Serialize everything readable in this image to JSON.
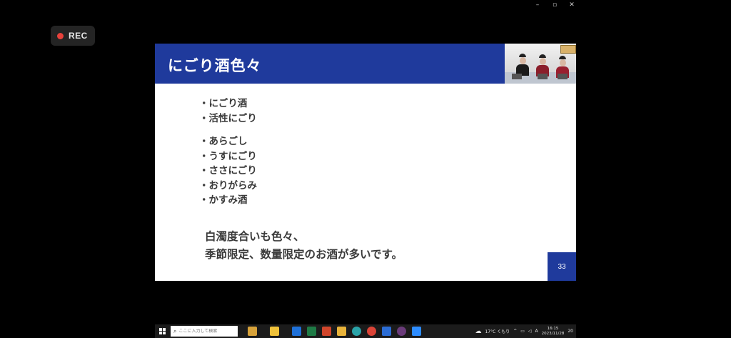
{
  "window": {
    "minimize_icon": "minimize-icon",
    "maximize_icon": "maximize-icon",
    "close_icon": "close-icon",
    "minimize_glyph": "–",
    "maximize_glyph": "▫",
    "close_glyph": "✕"
  },
  "recording": {
    "label": "REC",
    "color": "#e8413b"
  },
  "slide": {
    "title": "にごり酒色々",
    "header_color": "#1f3a9c",
    "bullets_group1": [
      "にごり酒",
      "活性にごり"
    ],
    "bullets_group2": [
      "あらごし",
      "うすにごり",
      "ささにごり",
      "おりがらみ",
      "かすみ酒"
    ],
    "summary_line1": "白濁度合いも色々、",
    "summary_line2": "季節限定、数量限定のお酒が多いです。",
    "page_number": "33"
  },
  "taskbar": {
    "search_placeholder": "ここに入力して検索",
    "weather": "17°C くもり",
    "ime": "A",
    "time": "16:15",
    "date": "2023/11/28",
    "notification_count": "20"
  }
}
